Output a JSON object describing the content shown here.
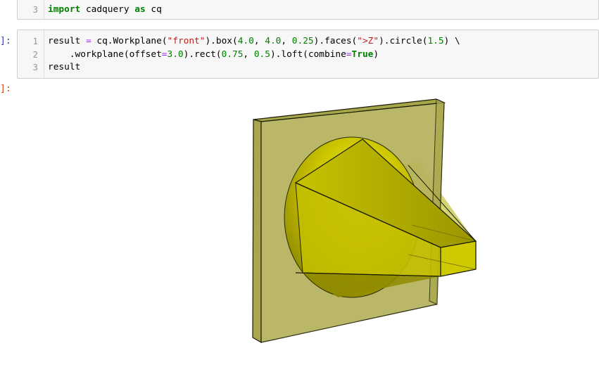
{
  "cell1": {
    "prompt": "",
    "line_number": "3",
    "code_tokens": [
      {
        "t": "import",
        "c": "kw"
      },
      {
        "t": " cadquery ",
        "c": ""
      },
      {
        "t": "as",
        "c": "kw"
      },
      {
        "t": " cq",
        "c": ""
      }
    ]
  },
  "cell2": {
    "prompt": "]:",
    "lines": [
      {
        "n": "1",
        "tokens": [
          {
            "t": "result ",
            "c": ""
          },
          {
            "t": "=",
            "c": "op"
          },
          {
            "t": " cq.Workplane(",
            "c": ""
          },
          {
            "t": "\"front\"",
            "c": "str"
          },
          {
            "t": ").box(",
            "c": ""
          },
          {
            "t": "4.0",
            "c": "num"
          },
          {
            "t": ", ",
            "c": ""
          },
          {
            "t": "4.0",
            "c": "num"
          },
          {
            "t": ", ",
            "c": ""
          },
          {
            "t": "0.25",
            "c": "num"
          },
          {
            "t": ").faces(",
            "c": ""
          },
          {
            "t": "\">Z\"",
            "c": "str"
          },
          {
            "t": ").circle(",
            "c": ""
          },
          {
            "t": "1.5",
            "c": "num"
          },
          {
            "t": ") \\",
            "c": ""
          }
        ]
      },
      {
        "n": "2",
        "tokens": [
          {
            "t": "    .workplane(offset",
            "c": ""
          },
          {
            "t": "=",
            "c": "op"
          },
          {
            "t": "3.0",
            "c": "num"
          },
          {
            "t": ").rect(",
            "c": ""
          },
          {
            "t": "0.75",
            "c": "num"
          },
          {
            "t": ", ",
            "c": ""
          },
          {
            "t": "0.5",
            "c": "num"
          },
          {
            "t": ").loft(combine",
            "c": ""
          },
          {
            "t": "=",
            "c": "op"
          },
          {
            "t": "True",
            "c": "kw"
          },
          {
            "t": ")",
            "c": ""
          }
        ]
      },
      {
        "n": "3",
        "tokens": [
          {
            "t": "result",
            "c": ""
          }
        ]
      }
    ]
  },
  "output": {
    "prompt": "]:",
    "colors": {
      "plate_face": "#b5b35c",
      "plate_edge": "#9e9c3c",
      "cone_light": "#e6e22a",
      "cone_mid": "#c9c300",
      "cone_dark": "#8a8500",
      "outline": "#1a1a00"
    }
  }
}
